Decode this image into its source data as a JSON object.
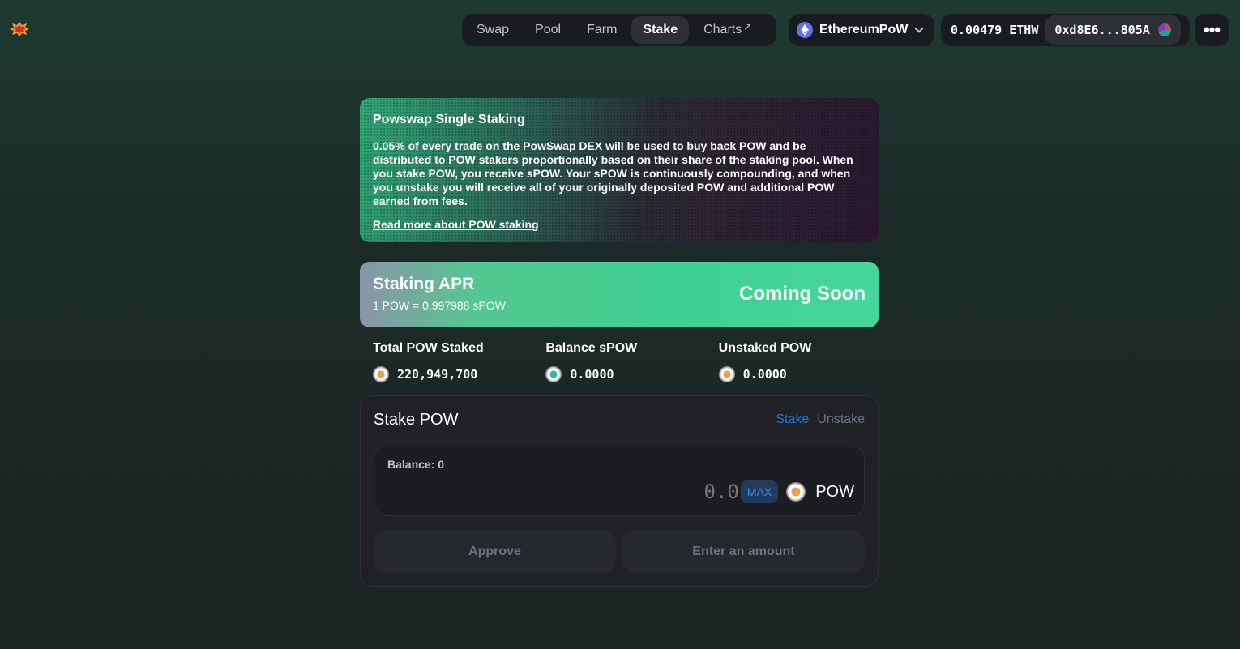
{
  "nav": {
    "items": [
      {
        "label": "Swap",
        "active": false
      },
      {
        "label": "Pool",
        "active": false
      },
      {
        "label": "Farm",
        "active": false
      },
      {
        "label": "Stake",
        "active": true
      },
      {
        "label": "Charts",
        "active": false,
        "external_icon": "arrow-up-right-icon"
      }
    ]
  },
  "network": {
    "name": "EthereumPoW",
    "icon": "ethereum-icon"
  },
  "wallet": {
    "balance": "0.00479 ETHW",
    "address": "0xd8E6...805A"
  },
  "more_label": "•••",
  "banner": {
    "title": "Powswap Single Staking",
    "text": "0.05% of every trade on the PowSwap DEX will be used to buy back POW and be distributed to POW stakers proportionally based on their share of the staking pool. When you stake POW, you receive sPOW. Your sPOW is continuously compounding, and when you unstake you will receive all of your originally deposited POW and additional POW earned from fees.",
    "link": "Read more about POW staking"
  },
  "apr": {
    "title": "Staking APR",
    "rate": "1 POW = 0.997988 sPOW",
    "value": "Coming Soon"
  },
  "stats": [
    {
      "label": "Total POW Staked",
      "value": "220,949,700",
      "icon": "pow-coin-icon"
    },
    {
      "label": "Balance sPOW",
      "value": "0.0000",
      "icon": "spow-coin-icon"
    },
    {
      "label": "Unstaked POW",
      "value": "0.0000",
      "icon": "pow-coin-icon"
    }
  ],
  "stake_card": {
    "title": "Stake POW",
    "tabs": {
      "stake": "Stake",
      "unstake": "Unstake"
    },
    "balance": "Balance: 0",
    "amount_placeholder": "0.0",
    "max": "MAX",
    "token": "POW",
    "approve": "Approve",
    "enter": "Enter an amount"
  },
  "colors": {
    "accent_blue": "#2172e5",
    "apr_green": "#3fd093",
    "card_bg": "#1f2125"
  }
}
